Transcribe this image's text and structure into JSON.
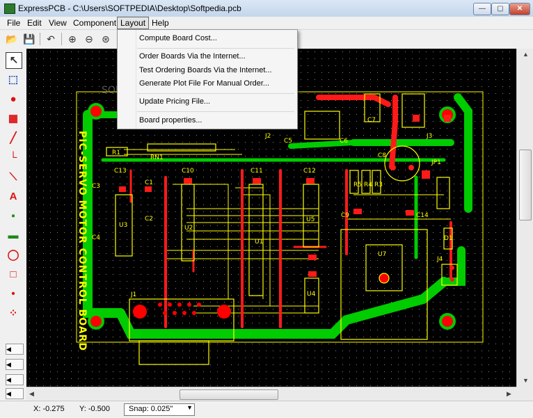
{
  "window": {
    "title": "ExpressPCB - C:\\Users\\SOFTPEDIA\\Desktop\\Softpedia.pcb"
  },
  "controls": {
    "minimize": "—",
    "maximize": "▢",
    "close": "✕"
  },
  "menubar": {
    "items": [
      "File",
      "Edit",
      "View",
      "Component",
      "Layout",
      "Help"
    ]
  },
  "layout_menu": {
    "items": [
      "Compute Board Cost...",
      "Order Boards Via the Internet...",
      "Test Ordering Boards Via the Internet...",
      "Generate Plot File For Manual Order...",
      "Update Pricing File...",
      "Board properties..."
    ]
  },
  "toolbar": {
    "icons": [
      "open-icon",
      "save-icon",
      "undo-icon",
      "zoom-in-icon",
      "zoom-out-icon",
      "zoom-fit-icon"
    ],
    "glyphs": [
      "📂",
      "💾",
      "↶",
      "⊕",
      "⊖",
      "⊛"
    ]
  },
  "left_tools": {
    "glyphs": [
      "↖",
      "⬚",
      "●",
      "▦",
      "╱",
      "└",
      "⟍",
      "A",
      "▪",
      "▬",
      "◯",
      "□",
      "•",
      "⁘"
    ]
  },
  "layers": {
    "labels": [
      "◀",
      "◀",
      "◀",
      "◀"
    ]
  },
  "board": {
    "silkscreen": "PIC-SERVO MOTOR CONTROL BOARD",
    "watermark": "SOFTPEDIA",
    "labels": [
      "J2",
      "J3",
      "J1",
      "J4",
      "JP1",
      "C8",
      "C7",
      "C6",
      "C5",
      "C4",
      "C3",
      "C1",
      "C2",
      "C9",
      "C10",
      "C11",
      "C12",
      "C13",
      "C14",
      "RN1",
      "R1",
      "R3",
      "R4",
      "R5",
      "U1",
      "U2",
      "U3",
      "U4",
      "U5",
      "U7",
      "D1"
    ]
  },
  "status": {
    "x": "X: -0.275",
    "y": "Y: -0.500",
    "snap": "Snap:  0.025\"",
    "snap_arrow": "▼"
  },
  "colors": {
    "canvas": "#000000",
    "copper_top": "#ff0000",
    "copper_bottom": "#00cc00",
    "silkscreen": "#ffff00"
  }
}
